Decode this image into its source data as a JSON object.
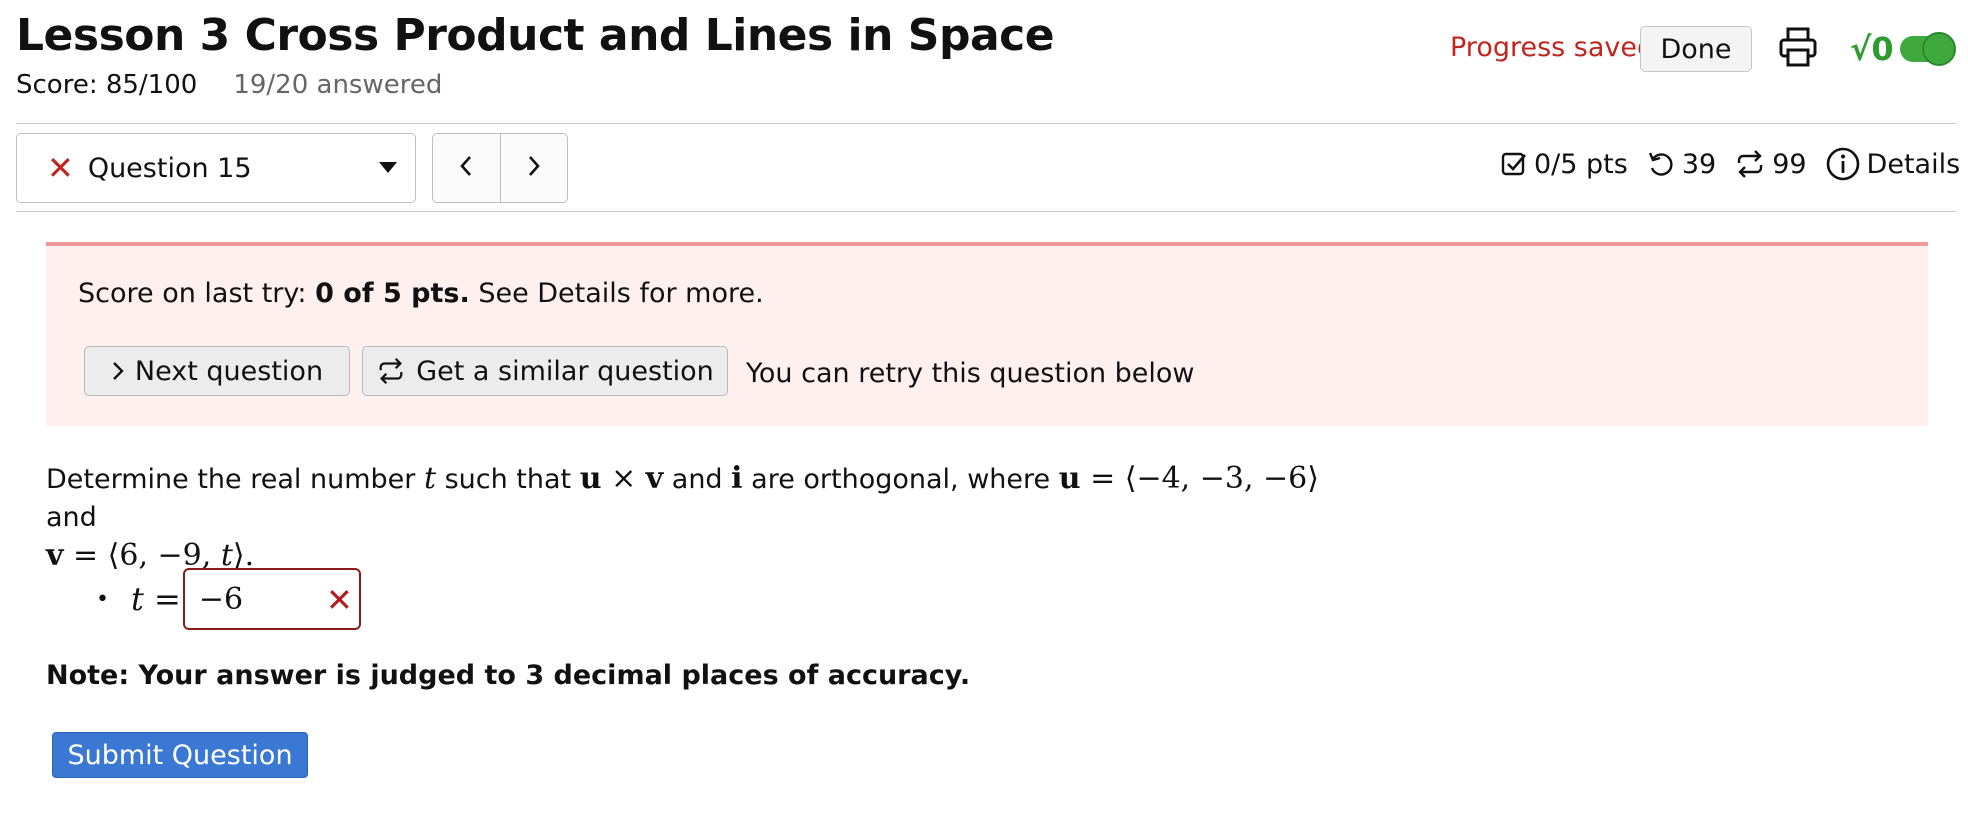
{
  "header": {
    "title": "Lesson 3 Cross Product and Lines in Space",
    "score": "Score: 85/100",
    "answered": "19/20 answered",
    "progress_status": "Progress saved",
    "done_label": "Done",
    "math_toggle_label": "√0"
  },
  "nav": {
    "question_label": "Question 15",
    "prev_glyph": "‹",
    "next_glyph": "›",
    "points": "0/5 pts",
    "retries": "39",
    "similar_count": "99",
    "details_label": "Details"
  },
  "alert": {
    "prefix": "Score on last try: ",
    "score_bold": "0 of 5 pts.",
    "suffix": " See Details for more.",
    "next_question_label": "Next question",
    "similar_question_label": "Get a similar question",
    "retry_text": "You can retry this question below"
  },
  "question": {
    "p1": "Determine the real number ",
    "t": "t",
    "p2": " such that ",
    "u": "u",
    "cross": " × ",
    "v": "v",
    "p3": " and ",
    "i": "i",
    "p4": " are orthogonal, where ",
    "u_def": " = ⟨−4, −3, −6⟩",
    "p5": " and",
    "v_def": " = ⟨6, −9, ",
    "v_end": "⟩.",
    "answer_lhs": "t =",
    "answer_value": "−6",
    "wrong_mark": "✕"
  },
  "note": "Note: Your answer is judged to 3 decimal places of accuracy.",
  "submit_label": "Submit Question",
  "colors": {
    "error_red": "#c0251e",
    "alert_bg": "#fdf0ef",
    "submit_blue": "#3a78d4",
    "toggle_green": "#3fa93f"
  }
}
